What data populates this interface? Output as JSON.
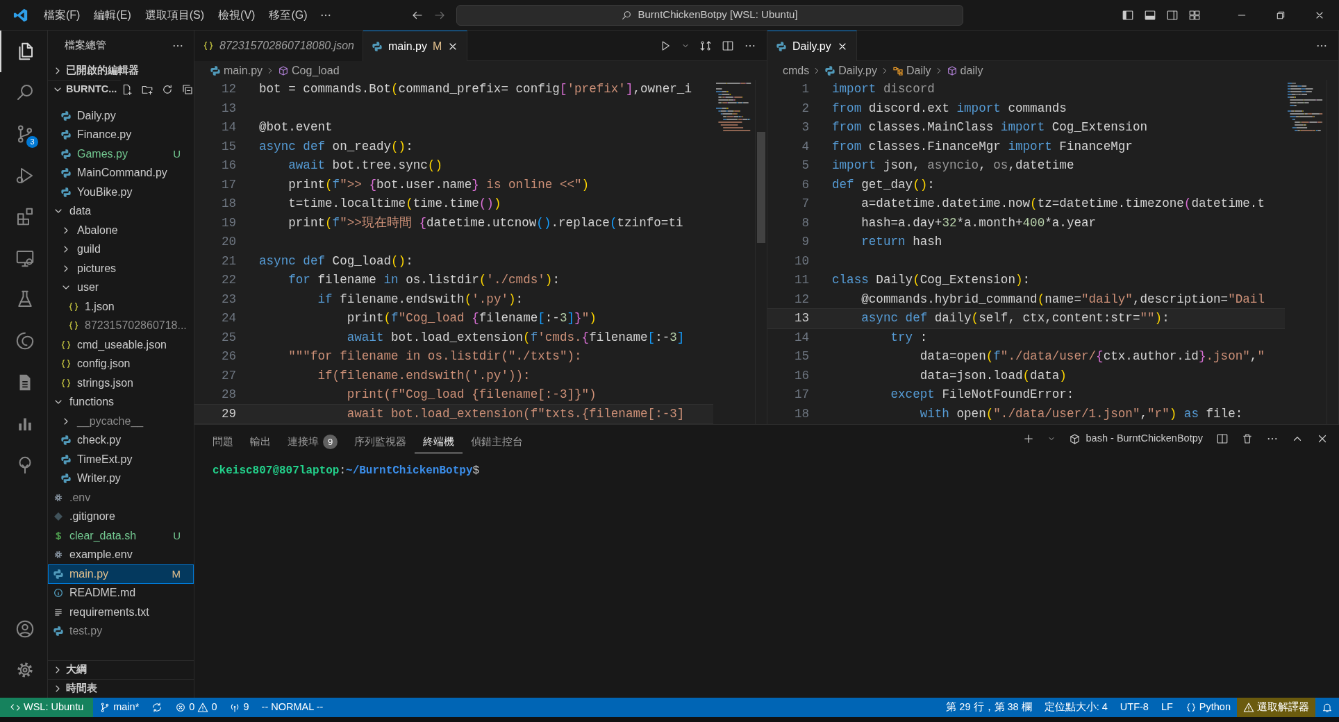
{
  "title_bar": {
    "menus": [
      "檔案(F)",
      "編輯(E)",
      "選取項目(S)",
      "檢視(V)",
      "移至(G)"
    ],
    "search": "BurntChickenBotpy [WSL: Ubuntu]"
  },
  "activity_bar": {
    "items": [
      {
        "selected": true
      },
      {
        "selected": false
      },
      {
        "selected": false,
        "badge": "3"
      },
      {
        "selected": false
      },
      {
        "selected": false
      },
      {
        "selected": false
      },
      {
        "selected": false
      },
      {
        "selected": false
      },
      {
        "selected": false
      },
      {
        "selected": false
      },
      {
        "selected": false
      }
    ]
  },
  "sidebar": {
    "title": "檔案總管",
    "open_editors": {
      "label": "已開啟的編輯器",
      "expanded": false
    },
    "folder": {
      "label": "BURNTC...",
      "expanded": true,
      "tree": [
        {
          "kind": "folder-continued",
          "children": [
            {
              "label": "Daily.py",
              "kind": "python",
              "color": "#cccccc",
              "selected": false
            },
            {
              "label": "Finance.py",
              "kind": "python",
              "color": "#cccccc",
              "selected": false
            },
            {
              "label": "Games.py",
              "kind": "python",
              "color": "#73c991",
              "badge": "U",
              "selected": false
            },
            {
              "label": "MainCommand.py",
              "kind": "python",
              "color": "#cccccc",
              "selected": false
            },
            {
              "label": "YouBike.py",
              "kind": "python",
              "color": "#cccccc",
              "selected": false
            }
          ]
        },
        {
          "label": "data",
          "kind": "folder",
          "expanded": true,
          "color": "#cccccc",
          "selected": false,
          "children": [
            {
              "label": "Abalone",
              "kind": "folder",
              "expanded": false,
              "color": "#cccccc",
              "selected": false
            },
            {
              "label": "guild",
              "kind": "folder",
              "expanded": false,
              "color": "#cccccc",
              "selected": false
            },
            {
              "label": "pictures",
              "kind": "folder",
              "expanded": false,
              "color": "#cccccc",
              "selected": false
            },
            {
              "label": "user",
              "kind": "folder",
              "expanded": true,
              "color": "#cccccc",
              "selected": false,
              "children": [
                {
                  "label": "1.json",
                  "kind": "json",
                  "color": "#cccccc",
                  "selected": false
                },
                {
                  "label": "872315702860718...",
                  "kind": "json",
                  "color": "#8c8c8c",
                  "selected": false
                }
              ]
            },
            {
              "label": "cmd_useable.json",
              "kind": "json",
              "color": "#cccccc",
              "selected": false
            },
            {
              "label": "config.json",
              "kind": "json",
              "color": "#cccccc",
              "selected": false
            },
            {
              "label": "strings.json",
              "kind": "json",
              "color": "#cccccc",
              "selected": false
            }
          ]
        },
        {
          "label": "functions",
          "kind": "folder",
          "expanded": true,
          "color": "#cccccc",
          "selected": false,
          "children": [
            {
              "label": "__pycache__",
              "kind": "folder",
              "expanded": false,
              "color": "#8c8c8c",
              "selected": false
            },
            {
              "label": "check.py",
              "kind": "python",
              "color": "#cccccc",
              "selected": false
            },
            {
              "label": "TimeExt.py",
              "kind": "python",
              "color": "#cccccc",
              "selected": false
            },
            {
              "label": "Writer.py",
              "kind": "python",
              "color": "#cccccc",
              "selected": false
            }
          ]
        },
        {
          "label": ".env",
          "kind": "config",
          "color": "#8c8c8c",
          "selected": false
        },
        {
          "label": ".gitignore",
          "kind": "git",
          "color": "#cccccc",
          "selected": false
        },
        {
          "label": "clear_data.sh",
          "kind": "shell",
          "color": "#73c991",
          "badge": "U",
          "selected": false
        },
        {
          "label": "example.env",
          "kind": "config",
          "color": "#cccccc",
          "selected": false
        },
        {
          "label": "main.py",
          "kind": "python",
          "color": "#e2c08d",
          "badge": "M",
          "selected": true
        },
        {
          "label": "README.md",
          "kind": "info",
          "color": "#cccccc",
          "selected": false
        },
        {
          "label": "requirements.txt",
          "kind": "text",
          "color": "#cccccc",
          "selected": false
        },
        {
          "label": "test.py",
          "kind": "python",
          "color": "#8c8c8c",
          "selected": false
        }
      ]
    },
    "footer_sections": [
      {
        "label": "大綱",
        "expanded": false
      },
      {
        "label": "時間表",
        "expanded": false
      }
    ]
  },
  "editor_groups": [
    {
      "toolbar": true,
      "tabs": [
        {
          "label": "872315702860718080.json",
          "kind": "json",
          "preview": true,
          "selected": false
        },
        {
          "label": "main.py",
          "kind": "python",
          "preview": false,
          "selected": true,
          "badge": "M"
        }
      ],
      "breadcrumbs": [
        {
          "label": "main.py",
          "kind": "python"
        },
        {
          "label": "Cog_load",
          "kind": "method"
        }
      ],
      "lines": [
        {
          "number": "12",
          "current": false,
          "tokens": [
            {
              "kind": "plain",
              "text": "bot = commands.Bot"
            },
            {
              "kind": "bracket1",
              "text": "("
            },
            {
              "kind": "plain",
              "text": "command_prefix= config"
            },
            {
              "kind": "bracket2",
              "text": "["
            },
            {
              "kind": "string",
              "text": "'prefix'"
            },
            {
              "kind": "bracket2",
              "text": "]"
            },
            {
              "kind": "plain",
              "text": ",owner_i"
            }
          ]
        },
        {
          "number": "13",
          "current": false
        },
        {
          "number": "14",
          "current": false,
          "tokens": [
            {
              "kind": "plain",
              "text": "@bot.event"
            }
          ]
        },
        {
          "number": "15",
          "current": false,
          "tokens": [
            {
              "kind": "keyword",
              "text": "async def "
            },
            {
              "kind": "plain",
              "text": "on_ready"
            },
            {
              "kind": "bracket1",
              "text": "()"
            },
            {
              "kind": "plain",
              "text": ":"
            }
          ]
        },
        {
          "number": "16",
          "current": false,
          "tokens": [
            {
              "kind": "keyword",
              "text": "    await "
            },
            {
              "kind": "plain",
              "text": "bot.tree.sync"
            },
            {
              "kind": "bracket1",
              "text": "()"
            }
          ]
        },
        {
          "number": "17",
          "current": false,
          "tokens": [
            {
              "kind": "plain",
              "text": "    print"
            },
            {
              "kind": "bracket1",
              "text": "("
            },
            {
              "kind": "keyword",
              "text": "f"
            },
            {
              "kind": "string",
              "text": "\">> "
            },
            {
              "kind": "bracket2",
              "text": "{"
            },
            {
              "kind": "plain",
              "text": "bot.user.name"
            },
            {
              "kind": "bracket2",
              "text": "}"
            },
            {
              "kind": "string",
              "text": " is online <<\""
            },
            {
              "kind": "bracket1",
              "text": ")"
            }
          ]
        },
        {
          "number": "18",
          "current": false,
          "tokens": [
            {
              "kind": "plain",
              "text": "    t=time.localtime"
            },
            {
              "kind": "bracket1",
              "text": "("
            },
            {
              "kind": "plain",
              "text": "time.time"
            },
            {
              "kind": "bracket2",
              "text": "()"
            },
            {
              "kind": "bracket1",
              "text": ")"
            }
          ]
        },
        {
          "number": "19",
          "current": false,
          "tokens": [
            {
              "kind": "plain",
              "text": "    print"
            },
            {
              "kind": "bracket1",
              "text": "("
            },
            {
              "kind": "keyword",
              "text": "f"
            },
            {
              "kind": "string",
              "text": "\">>現在時間 "
            },
            {
              "kind": "bracket2",
              "text": "{"
            },
            {
              "kind": "plain",
              "text": "datetime.utcnow"
            },
            {
              "kind": "bracket3",
              "text": "()"
            },
            {
              "kind": "plain",
              "text": ".replace"
            },
            {
              "kind": "bracket3",
              "text": "("
            },
            {
              "kind": "plain",
              "text": "tzinfo=ti"
            }
          ]
        },
        {
          "number": "20",
          "current": false
        },
        {
          "number": "21",
          "current": false,
          "tokens": [
            {
              "kind": "keyword",
              "text": "async def "
            },
            {
              "kind": "plain",
              "text": "Cog_load"
            },
            {
              "kind": "bracket1",
              "text": "()"
            },
            {
              "kind": "plain",
              "text": ":"
            }
          ]
        },
        {
          "number": "22",
          "current": false,
          "tokens": [
            {
              "kind": "keyword",
              "text": "    for "
            },
            {
              "kind": "plain",
              "text": "filename "
            },
            {
              "kind": "keyword",
              "text": "in "
            },
            {
              "kind": "plain",
              "text": "os.listdir"
            },
            {
              "kind": "bracket1",
              "text": "("
            },
            {
              "kind": "string",
              "text": "'./cmds'"
            },
            {
              "kind": "bracket1",
              "text": ")"
            },
            {
              "kind": "plain",
              "text": ":"
            }
          ]
        },
        {
          "number": "23",
          "current": false,
          "tokens": [
            {
              "kind": "keyword",
              "text": "        if "
            },
            {
              "kind": "plain",
              "text": "filename.endswith"
            },
            {
              "kind": "bracket1",
              "text": "("
            },
            {
              "kind": "string",
              "text": "'.py'"
            },
            {
              "kind": "bracket1",
              "text": ")"
            },
            {
              "kind": "plain",
              "text": ":"
            }
          ]
        },
        {
          "number": "24",
          "current": false,
          "tokens": [
            {
              "kind": "plain",
              "text": "            print"
            },
            {
              "kind": "bracket1",
              "text": "("
            },
            {
              "kind": "keyword",
              "text": "f"
            },
            {
              "kind": "string",
              "text": "\"Cog_load "
            },
            {
              "kind": "bracket2",
              "text": "{"
            },
            {
              "kind": "plain",
              "text": "filename"
            },
            {
              "kind": "bracket3",
              "text": "["
            },
            {
              "kind": "plain",
              "text": ":-"
            },
            {
              "kind": "number",
              "text": "3"
            },
            {
              "kind": "bracket3",
              "text": "]"
            },
            {
              "kind": "bracket2",
              "text": "}"
            },
            {
              "kind": "string",
              "text": "\""
            },
            {
              "kind": "bracket1",
              "text": ")"
            }
          ]
        },
        {
          "number": "25",
          "current": false,
          "tokens": [
            {
              "kind": "keyword",
              "text": "            await "
            },
            {
              "kind": "plain",
              "text": "bot.load_extension"
            },
            {
              "kind": "bracket1",
              "text": "("
            },
            {
              "kind": "keyword",
              "text": "f"
            },
            {
              "kind": "string",
              "text": "'cmds."
            },
            {
              "kind": "bracket2",
              "text": "{"
            },
            {
              "kind": "plain",
              "text": "filename"
            },
            {
              "kind": "bracket3",
              "text": "["
            },
            {
              "kind": "plain",
              "text": ":-"
            },
            {
              "kind": "number",
              "text": "3"
            },
            {
              "kind": "bracket3",
              "text": "]"
            }
          ]
        },
        {
          "number": "26",
          "current": false,
          "tokens": [
            {
              "kind": "string",
              "text": "    \"\"\"for filename in os.listdir(\"./txts\"):"
            }
          ]
        },
        {
          "number": "27",
          "current": false,
          "tokens": [
            {
              "kind": "string",
              "text": "        if(filename.endswith('.py')):"
            }
          ]
        },
        {
          "number": "28",
          "current": false,
          "tokens": [
            {
              "kind": "string",
              "text": "            print(f\"Cog_load {filename[:-3]}\")"
            }
          ]
        },
        {
          "number": "29",
          "current": true,
          "tokens": [
            {
              "kind": "string",
              "text": "            await bot.load_extension(f\"txts.{filename[:-3]"
            }
          ]
        }
      ]
    },
    {
      "tabs": [
        {
          "label": "Daily.py",
          "kind": "python",
          "preview": false,
          "selected": true
        }
      ],
      "breadcrumbs": [
        {
          "label": "cmds",
          "kind": "folder"
        },
        {
          "label": "Daily.py",
          "kind": "python"
        },
        {
          "label": "Daily",
          "kind": "class"
        },
        {
          "label": "daily",
          "kind": "method"
        }
      ],
      "lines": [
        {
          "number": "1",
          "current": false,
          "tokens": [
            {
              "kind": "keyword",
              "text": "import "
            },
            {
              "kind": "dim",
              "text": "discord"
            }
          ]
        },
        {
          "number": "2",
          "current": false,
          "tokens": [
            {
              "kind": "keyword",
              "text": "from "
            },
            {
              "kind": "plain",
              "text": "discord.ext "
            },
            {
              "kind": "keyword",
              "text": "import "
            },
            {
              "kind": "plain",
              "text": "commands"
            }
          ]
        },
        {
          "number": "3",
          "current": false,
          "tokens": [
            {
              "kind": "keyword",
              "text": "from "
            },
            {
              "kind": "plain",
              "text": "classes.MainClass "
            },
            {
              "kind": "keyword",
              "text": "import "
            },
            {
              "kind": "plain",
              "text": "Cog_Extension"
            }
          ]
        },
        {
          "number": "4",
          "current": false,
          "tokens": [
            {
              "kind": "keyword",
              "text": "from "
            },
            {
              "kind": "plain",
              "text": "classes.FinanceMgr "
            },
            {
              "kind": "keyword",
              "text": "import "
            },
            {
              "kind": "plain",
              "text": "FinanceMgr"
            }
          ]
        },
        {
          "number": "5",
          "current": false,
          "tokens": [
            {
              "kind": "keyword",
              "text": "import "
            },
            {
              "kind": "plain",
              "text": "json, "
            },
            {
              "kind": "dim",
              "text": "asyncio"
            },
            {
              "kind": "plain",
              "text": ", "
            },
            {
              "kind": "dim",
              "text": "os"
            },
            {
              "kind": "plain",
              "text": ",datetime"
            }
          ]
        },
        {
          "number": "6",
          "current": false,
          "tokens": [
            {
              "kind": "keyword",
              "text": "def "
            },
            {
              "kind": "plain",
              "text": "get_day"
            },
            {
              "kind": "bracket1",
              "text": "()"
            },
            {
              "kind": "plain",
              "text": ":"
            }
          ]
        },
        {
          "number": "7",
          "current": false,
          "tokens": [
            {
              "kind": "plain",
              "text": "    a=datetime.datetime.now"
            },
            {
              "kind": "bracket1",
              "text": "("
            },
            {
              "kind": "plain",
              "text": "tz=datetime.timezone"
            },
            {
              "kind": "bracket2",
              "text": "("
            },
            {
              "kind": "plain",
              "text": "datetime.t"
            }
          ]
        },
        {
          "number": "8",
          "current": false,
          "tokens": [
            {
              "kind": "plain",
              "text": "    hash=a.day+"
            },
            {
              "kind": "number",
              "text": "32"
            },
            {
              "kind": "plain",
              "text": "*a.month+"
            },
            {
              "kind": "number",
              "text": "400"
            },
            {
              "kind": "plain",
              "text": "*a.year"
            }
          ]
        },
        {
          "number": "9",
          "current": false,
          "tokens": [
            {
              "kind": "keyword",
              "text": "    return "
            },
            {
              "kind": "plain",
              "text": "hash"
            }
          ]
        },
        {
          "number": "10",
          "current": false
        },
        {
          "number": "11",
          "current": false,
          "tokens": [
            {
              "kind": "keyword",
              "text": "class "
            },
            {
              "kind": "plain",
              "text": "Daily"
            },
            {
              "kind": "bracket1",
              "text": "("
            },
            {
              "kind": "plain",
              "text": "Cog_Extension"
            },
            {
              "kind": "bracket1",
              "text": ")"
            },
            {
              "kind": "plain",
              "text": ":"
            }
          ]
        },
        {
          "number": "12",
          "current": false,
          "tokens": [
            {
              "kind": "plain",
              "text": "    @commands.hybrid_command"
            },
            {
              "kind": "bracket1",
              "text": "("
            },
            {
              "kind": "plain",
              "text": "name="
            },
            {
              "kind": "string",
              "text": "\"daily\""
            },
            {
              "kind": "plain",
              "text": ",description="
            },
            {
              "kind": "string",
              "text": "\"Dail"
            }
          ]
        },
        {
          "number": "13",
          "current": true,
          "tokens": [
            {
              "kind": "keyword",
              "text": "    async def "
            },
            {
              "kind": "plain",
              "text": "daily"
            },
            {
              "kind": "bracket1",
              "text": "("
            },
            {
              "kind": "plain",
              "text": "self, ctx,content:str="
            },
            {
              "kind": "string",
              "text": "\"\""
            },
            {
              "kind": "bracket1",
              "text": ")"
            },
            {
              "kind": "plain",
              "text": ":"
            }
          ]
        },
        {
          "number": "14",
          "current": false,
          "tokens": [
            {
              "kind": "keyword",
              "text": "        try "
            },
            {
              "kind": "plain",
              "text": ":"
            }
          ]
        },
        {
          "number": "15",
          "current": false,
          "tokens": [
            {
              "kind": "plain",
              "text": "            data=open"
            },
            {
              "kind": "bracket1",
              "text": "("
            },
            {
              "kind": "keyword",
              "text": "f"
            },
            {
              "kind": "string",
              "text": "\"./data/user/"
            },
            {
              "kind": "bracket2",
              "text": "{"
            },
            {
              "kind": "plain",
              "text": "ctx.author.id"
            },
            {
              "kind": "bracket2",
              "text": "}"
            },
            {
              "kind": "string",
              "text": ".json\""
            },
            {
              "kind": "plain",
              "text": ","
            },
            {
              "kind": "string",
              "text": "\""
            }
          ]
        },
        {
          "number": "16",
          "current": false,
          "tokens": [
            {
              "kind": "plain",
              "text": "            data=json.load"
            },
            {
              "kind": "bracket1",
              "text": "("
            },
            {
              "kind": "plain",
              "text": "data"
            },
            {
              "kind": "bracket1",
              "text": ")"
            }
          ]
        },
        {
          "number": "17",
          "current": false,
          "tokens": [
            {
              "kind": "keyword",
              "text": "        except "
            },
            {
              "kind": "plain",
              "text": "FileNotFoundError:"
            }
          ]
        },
        {
          "number": "18",
          "current": false,
          "tokens": [
            {
              "kind": "keyword",
              "text": "            with "
            },
            {
              "kind": "plain",
              "text": "open"
            },
            {
              "kind": "bracket1",
              "text": "("
            },
            {
              "kind": "string",
              "text": "\"./data/user/1.json\""
            },
            {
              "kind": "plain",
              "text": ","
            },
            {
              "kind": "string",
              "text": "\"r\""
            },
            {
              "kind": "bracket1",
              "text": ")"
            },
            {
              "kind": "keyword",
              "text": " as "
            },
            {
              "kind": "plain",
              "text": "file:"
            }
          ]
        }
      ]
    }
  ],
  "panel": {
    "tabs": [
      {
        "label": "問題",
        "selected": false
      },
      {
        "label": "輸出",
        "selected": false
      },
      {
        "label": "連接埠",
        "selected": false,
        "badge": "9"
      },
      {
        "label": "序列監視器",
        "selected": false
      },
      {
        "label": "終端機",
        "selected": true
      },
      {
        "label": "偵錯主控台",
        "selected": false
      }
    ],
    "terminal_name": "bash - BurntChickenBotpy",
    "prompt": {
      "user": "ckeisc807@807laptop",
      "separator": ":",
      "path": "~/BurntChickenBotpy",
      "symbol": "$"
    }
  },
  "status_bar": {
    "left": [
      {
        "kind": "remote",
        "text": "WSL: Ubuntu"
      },
      {
        "kind": "branch",
        "text": "main*"
      },
      {
        "kind": "sync"
      },
      {
        "kind": "problems",
        "errors": "0",
        "warnings": "0"
      },
      {
        "kind": "ports",
        "text": "9"
      },
      {
        "kind": "plain",
        "text": "-- NORMAL --"
      }
    ],
    "right": [
      {
        "kind": "plain",
        "text": "第 29 行，第 38 欄"
      },
      {
        "kind": "plain",
        "text": "定位點大小: 4"
      },
      {
        "kind": "plain",
        "text": "UTF-8"
      },
      {
        "kind": "plain",
        "text": "LF"
      },
      {
        "kind": "language",
        "text": "Python"
      },
      {
        "kind": "warning",
        "text": "選取解譯器"
      },
      {
        "kind": "bell"
      }
    ]
  }
}
